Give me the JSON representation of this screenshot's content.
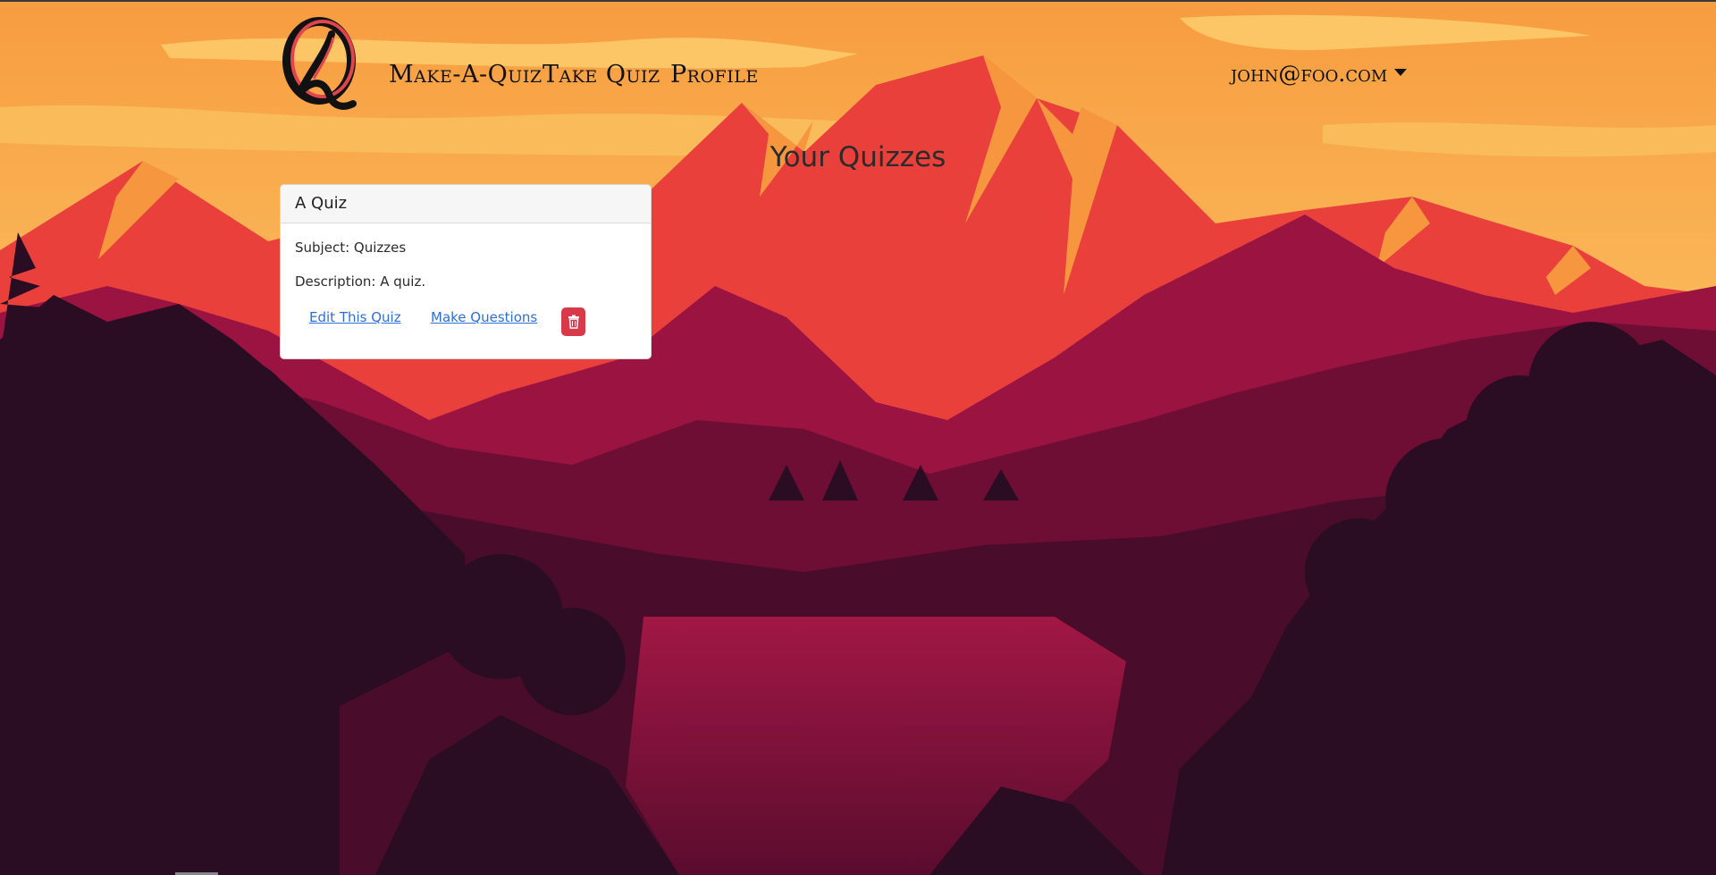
{
  "app": {
    "logo_icon": "quiz-q-logo-icon",
    "brand_colors": {
      "logo_red": "#e0454d",
      "logo_black": "#111111"
    }
  },
  "nav": {
    "links": [
      "Make-A-Quiz",
      "Take Quiz",
      "Profile"
    ],
    "user_email": "john@foo.com",
    "user_menu_icon": "caret-down-icon"
  },
  "page": {
    "title": "Your Quizzes"
  },
  "quizzes": [
    {
      "title": "A Quiz",
      "subject_line": "Subject: Quizzes",
      "description_line": "Description: A quiz.",
      "edit_label": "Edit This Quiz",
      "questions_label": "Make Questions",
      "delete_icon": "trash-icon"
    }
  ],
  "colors": {
    "link": "#2d6fd6",
    "danger": "#d83a4a",
    "sky": "#f9a94a",
    "mountain_red": "#e9403b",
    "forest": "#2a0d22"
  }
}
